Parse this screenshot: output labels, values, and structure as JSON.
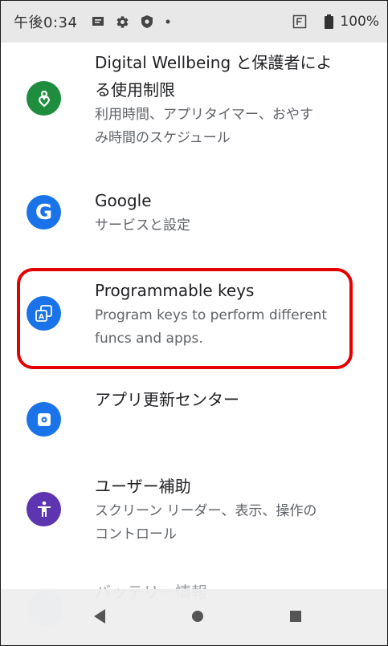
{
  "status_bar": {
    "time": "午後0:34",
    "left_icons": [
      "message-icon",
      "gear-icon",
      "shield-icon",
      "dot-icon"
    ],
    "right_icons": [
      "sim-icon",
      "battery-icon"
    ],
    "battery": "100%"
  },
  "settings": [
    {
      "title": "Digital Wellbeing と保護者による使用制限",
      "title_lines": [
        "Digital Wellbeing と保護者によ",
        "る使用制限"
      ],
      "summary_lines": [
        "利用時間、アプリタイマー、おやす",
        "み時間のスケジュール"
      ],
      "icon": "wellbeing-icon",
      "icon_color": "#1e8e3e"
    },
    {
      "title": "Google",
      "summary": "サービスと設定",
      "icon": "google-icon",
      "icon_color": "#1a73e8"
    },
    {
      "title": "Programmable keys",
      "summary_lines": [
        "Program keys to perform different",
        "funcs and apps."
      ],
      "icon": "programmable-keys-icon",
      "icon_color": "#1a73e8"
    },
    {
      "title": "アプリ更新センター",
      "icon": "app-update-icon",
      "icon_color": "#1a73e8"
    },
    {
      "title": "ユーザー補助",
      "summary_lines": [
        "スクリーン リーダー、表示、操作の",
        "コントロール"
      ],
      "icon": "accessibility-icon",
      "icon_color": "#5e35b1"
    },
    {
      "title": "バッテリー情報",
      "icon": "battery-info-icon",
      "icon_color": "#1a73e8"
    }
  ],
  "highlight_color": "#e50000",
  "nav": {
    "back": "back-icon",
    "home": "home-icon",
    "recents": "recents-icon"
  }
}
